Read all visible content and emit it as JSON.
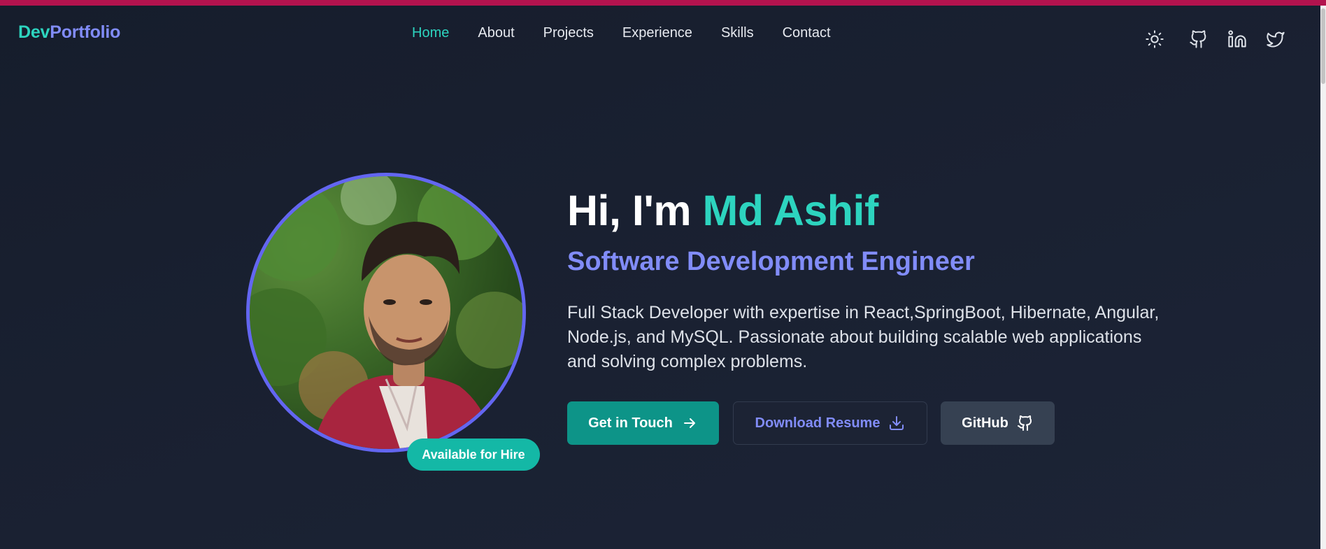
{
  "nav": {
    "logo_part1": "Dev",
    "logo_part2": "Portfolio",
    "links": [
      "Home",
      "About",
      "Projects",
      "Experience",
      "Skills",
      "Contact"
    ],
    "active": "Home",
    "icons": [
      "sun-icon",
      "github-icon",
      "linkedin-icon",
      "twitter-icon"
    ]
  },
  "hero": {
    "greeting": "Hi, I'm ",
    "name": "Md Ashif",
    "role": "Software Development Engineer",
    "description": "Full Stack Developer with expertise in React,SpringBoot, Hibernate, Angular, Node.js, and MySQL. Passionate about building scalable web applications and solving complex problems.",
    "badge": "Available for Hire",
    "buttons": {
      "contact": "Get in Touch",
      "resume": "Download Resume",
      "github": "GitHub"
    }
  },
  "colors": {
    "accent_teal": "#2dd4bf",
    "accent_indigo": "#818cf8",
    "background": "#171e2e",
    "top_strip": "#b3134e"
  }
}
